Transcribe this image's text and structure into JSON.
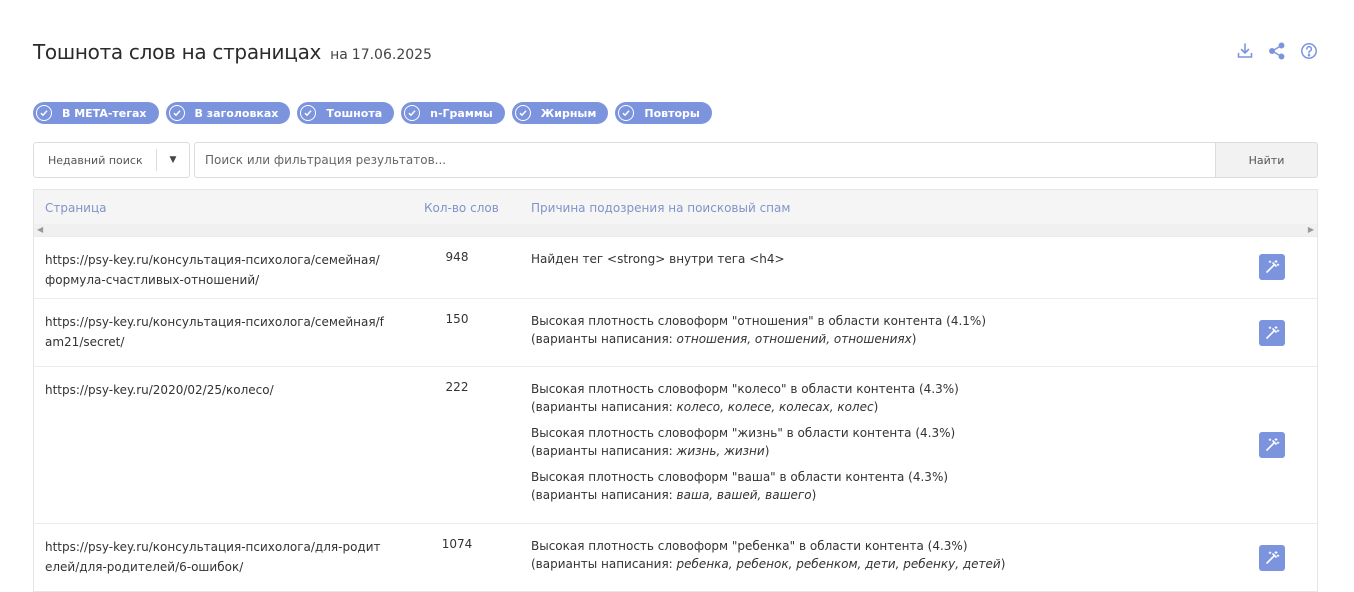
{
  "header": {
    "title": "Тошнота слов на страницах",
    "date_prefix": "на",
    "date": "17.06.2025",
    "actions": [
      {
        "icon": "download-icon"
      },
      {
        "icon": "share-icon"
      },
      {
        "icon": "help-icon"
      }
    ]
  },
  "filters": [
    {
      "label": "В META-тегах",
      "checked": true
    },
    {
      "label": "В заголовках",
      "checked": true
    },
    {
      "label": "Тошнота",
      "checked": true
    },
    {
      "label": "n-Граммы",
      "checked": true
    },
    {
      "label": "Жирным",
      "checked": true
    },
    {
      "label": "Повторы",
      "checked": true
    }
  ],
  "search": {
    "recent_label": "Недавний поиск",
    "placeholder": "Поиск или фильтрация результатов...",
    "button_label": "Найти"
  },
  "table": {
    "columns": {
      "page": "Страница",
      "count": "Кол-во слов",
      "reason": "Причина подозрения на поисковый спам"
    },
    "rows": [
      {
        "url": "https://psy-key.ru/консультация-психолога/семейная/формула-счастливых-отношений/",
        "count": "948",
        "reasons": [
          {
            "text": "Найден тег <strong> внутри тега <h4>",
            "variants_prefix": "",
            "variants": ""
          }
        ]
      },
      {
        "url": "https://psy-key.ru/консультация-психолога/семейная/fam21/secret/",
        "count": "150",
        "reasons": [
          {
            "text": "Высокая плотность словоформ \"отношения\" в области контента (4.1%)",
            "variants_prefix": "(варианты написания: ",
            "variants": "отношения, отношений, отношениях",
            "variants_suffix": ")"
          }
        ]
      },
      {
        "url": "https://psy-key.ru/2020/02/25/колесо/",
        "count": "222",
        "reasons": [
          {
            "text": "Высокая плотность словоформ \"колесо\" в области контента (4.3%)",
            "variants_prefix": "(варианты написания: ",
            "variants": "колесо, колесе, колесах, колес",
            "variants_suffix": ")"
          },
          {
            "text": "Высокая плотность словоформ \"жизнь\" в области контента (4.3%)",
            "variants_prefix": "(варианты написания: ",
            "variants": "жизнь, жизни",
            "variants_suffix": ")"
          },
          {
            "text": "Высокая плотность словоформ \"ваша\" в области контента (4.3%)",
            "variants_prefix": "(варианты написания: ",
            "variants": "ваша, вашей, вашего",
            "variants_suffix": ")"
          }
        ]
      },
      {
        "url": "https://psy-key.ru/консультация-психолога/для-родителей/для-родителей/6-ошибок/",
        "count": "1074",
        "reasons": [
          {
            "text": "Высокая плотность словоформ \"ребенка\" в области контента (4.3%)",
            "variants_prefix": "(варианты написания: ",
            "variants": "ребенка, ребенок, ребенком, дети, ребенку, детей",
            "variants_suffix": ")"
          }
        ]
      }
    ]
  },
  "colors": {
    "accent": "#7c94de",
    "header_text": "#8094c8"
  }
}
